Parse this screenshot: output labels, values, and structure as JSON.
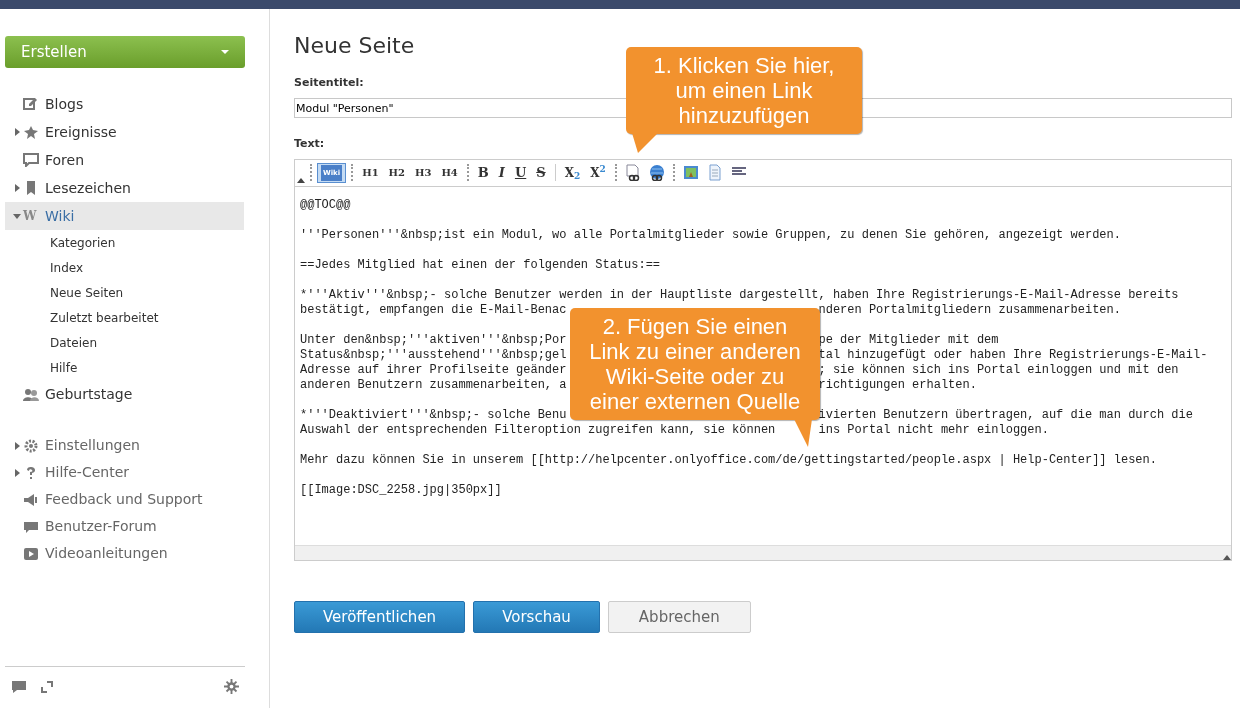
{
  "sidebar": {
    "create_button": "Erstellen",
    "items": [
      {
        "label": "Blogs",
        "selected": false
      },
      {
        "label": "Ereignisse",
        "selected": false,
        "expanded": false
      },
      {
        "label": "Foren",
        "selected": false
      },
      {
        "label": "Lesezeichen",
        "selected": false,
        "expanded": false
      },
      {
        "label": "Wiki",
        "icon": "W",
        "selected": true,
        "expanded": true,
        "children": [
          {
            "label": "Kategorien"
          },
          {
            "label": "Index"
          },
          {
            "label": "Neue Seiten"
          },
          {
            "label": "Zuletzt bearbeitet"
          },
          {
            "label": "Dateien"
          },
          {
            "label": "Hilfe"
          }
        ]
      },
      {
        "label": "Geburtstage",
        "selected": false
      }
    ],
    "help_items": [
      {
        "label": "Einstellungen",
        "expanded": false
      },
      {
        "label": "Hilfe-Center",
        "expanded": false
      },
      {
        "label": "Feedback und Support"
      },
      {
        "label": "Benutzer-Forum"
      },
      {
        "label": "Videoanleitungen"
      }
    ]
  },
  "page": {
    "title": "Neue Seite",
    "title_label": "Seitentitel:",
    "title_value": "Modul \"Personen\"",
    "text_label": "Text:",
    "toolbar": {
      "wiki_toggle": {
        "label": "Wiki",
        "selected": true
      },
      "headings": [
        "H1",
        "H2",
        "H3",
        "H4"
      ],
      "formats": [
        "B",
        "I",
        "U",
        "S"
      ],
      "scripts": [
        {
          "base": "X",
          "index": "2",
          "kind": "sub"
        },
        {
          "base": "X",
          "index": "2",
          "kind": "sup"
        }
      ]
    },
    "editor": [
      [
        {
          "text": "@@TOC@@"
        }
      ],
      [
        {
          "text": "'''Personen'''&nbsp;ist ein Modul, wo alle Portalmitglieder sowie Gruppen, zu denen Sie gehören, angezeigt werden."
        }
      ],
      [
        {
          "text": "==Jedes Mitglied hat einen der folgenden Status:=="
        }
      ],
      [
        {
          "text": "*'''Aktiv'''&nbsp;- solche Benutzer werden in der Hauptliste dargestellt, haben Ihre Registrierungs-E-Mail-Adresse bereits"
        },
        {
          "left": "bestätigt, empfangen die E-Mail-Benac",
          "right": "nderen Portalmitgliedern zusammenarbeiten."
        }
      ],
      [
        {
          "left": "Unter den&nbsp;'''aktiven'''&nbsp;Por",
          "right": "pe der Mitglieder mit dem"
        },
        {
          "left": "Status&nbsp;'''ausstehend'''&nbsp;gel",
          "right": "tal hinzugefügt oder haben Ihre Registrierungs-E-Mail-"
        },
        {
          "left": "Adresse auf ihrer Profilseite geänder",
          "right": "; sie können sich ins Portal einloggen und mit den"
        },
        {
          "left": "anderen Benutzern zusammenarbeiten, a",
          "right": "richtigungen erhalten."
        }
      ],
      [
        {
          "left": "*'''Deaktiviert'''&nbsp;- solche Benu",
          "right": "ivierten Benutzern übertragen, auf die man durch die"
        },
        {
          "left": "Auswahl der entsprechenden Filteroption zugreifen kann, sie können",
          "right": "ins Portal nicht mehr einloggen."
        }
      ],
      [
        {
          "text": "Mehr dazu können Sie in unserem [[http://helpcenter.onlyoffice.com/de/gettingstarted/people.aspx | Help-Center]] lesen."
        }
      ],
      [
        {
          "text": "[[Image:DSC_2258.jpg|350px]]"
        }
      ]
    ],
    "buttons": [
      {
        "label": "Veröffentlichen",
        "kind": "primary"
      },
      {
        "label": "Vorschau",
        "kind": "primary"
      },
      {
        "label": "Abbrechen",
        "kind": "secondary"
      }
    ]
  },
  "callouts": [
    {
      "text": "1. Klicken Sie hier, um einen Link hinzuzufügen",
      "kind": "tail-left"
    },
    {
      "text": "2. Fügen Sie einen Link zu einer anderen Wiki-Seite oder zu einer externen Quelle",
      "kind": "tail-right"
    }
  ]
}
